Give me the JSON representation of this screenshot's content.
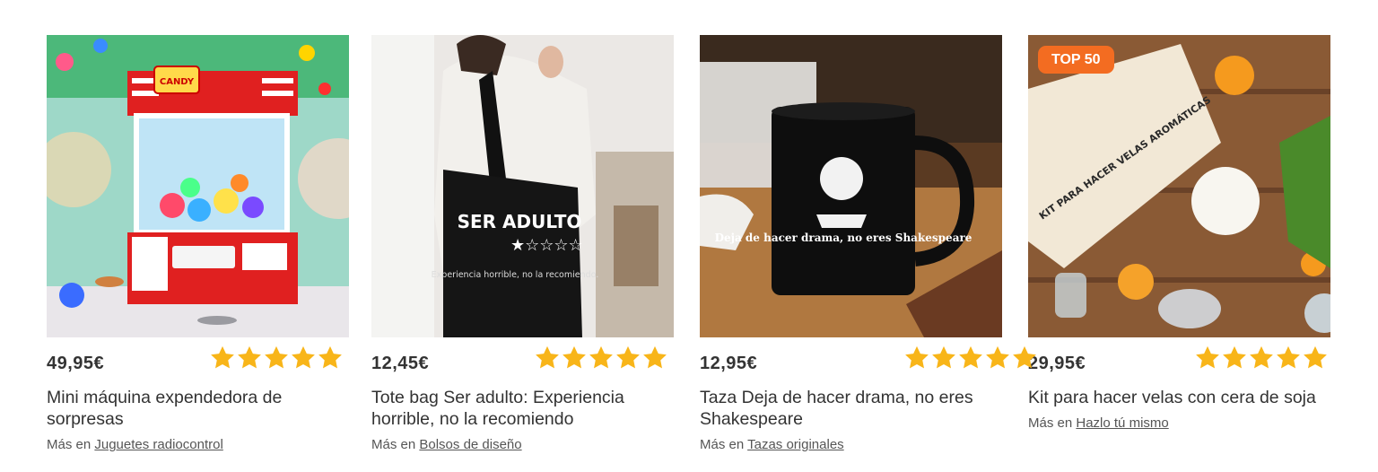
{
  "colors": {
    "star": "#f8b519",
    "badge": "#f36c21"
  },
  "products": [
    {
      "price": "49,95€",
      "rating": 5,
      "title": "Mini máquina expendedora de sorpresas",
      "more_prefix": "Más en",
      "category": "Juguetes radiocontrol",
      "badge": null,
      "image_text": "CANDY"
    },
    {
      "price": "12,45€",
      "rating": 5,
      "title": "Tote bag Ser adulto: Experiencia horrible, no la recomiendo",
      "more_prefix": "Más en",
      "category": "Bolsos de diseño",
      "badge": null,
      "image_text": "SER ADULTO",
      "image_subtext": "Experiencia horrible, no la recomiendo."
    },
    {
      "price": "12,95€",
      "rating": 5,
      "title": "Taza Deja de hacer drama, no eres Shakespeare",
      "more_prefix": "Más en",
      "category": "Tazas originales",
      "badge": null,
      "image_text": "Deja de hacer drama, no eres Shakespeare"
    },
    {
      "price": "29,95€",
      "rating": 5,
      "title": "Kit para hacer velas con cera de soja",
      "more_prefix": "Más en",
      "category": "Hazlo tú mismo",
      "badge": "TOP 50",
      "image_text": "KIT PARA HACER VELAS AROMÁTICAS"
    }
  ]
}
